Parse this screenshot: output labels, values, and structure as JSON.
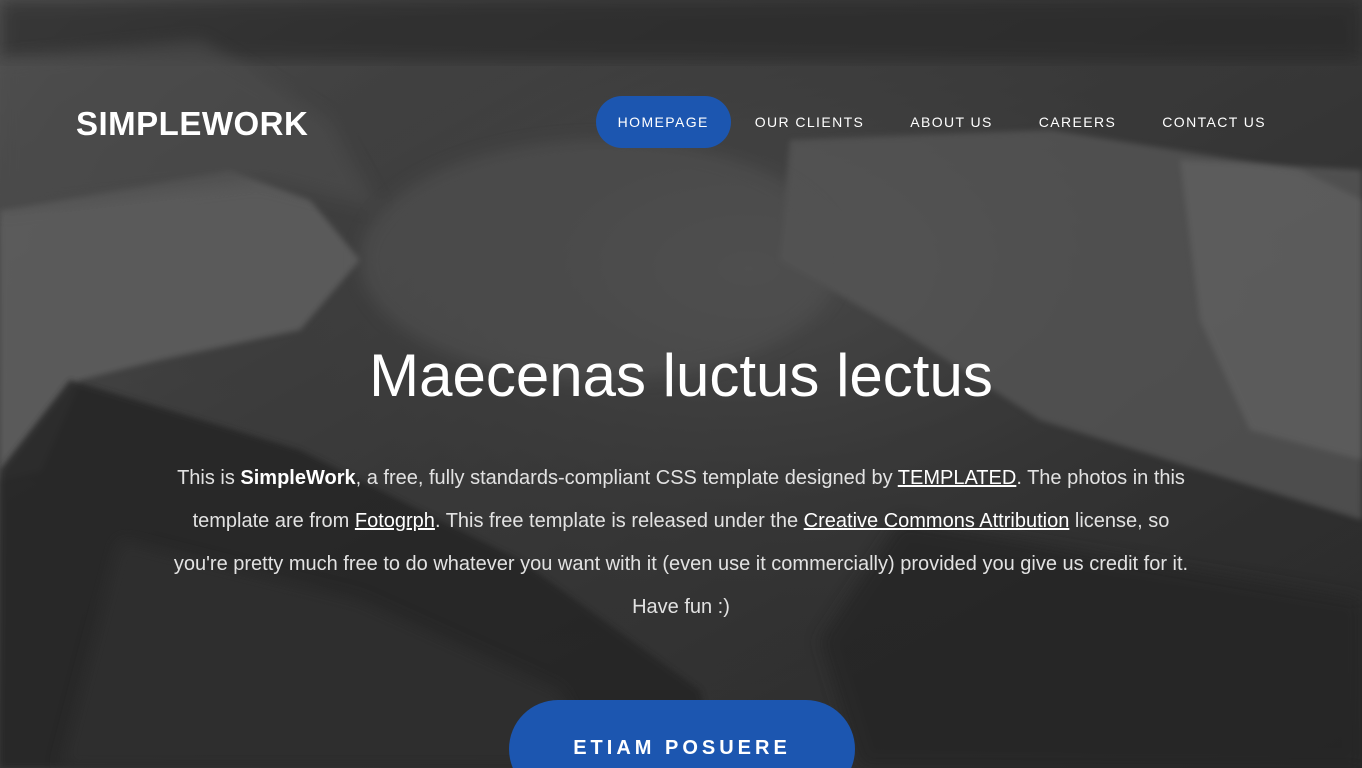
{
  "brand": {
    "logo_text": "SIMPLEWORK"
  },
  "nav": {
    "items": [
      {
        "label": "HOMEPAGE",
        "active": true
      },
      {
        "label": "OUR CLIENTS",
        "active": false
      },
      {
        "label": "ABOUT US",
        "active": false
      },
      {
        "label": "CAREERS",
        "active": false
      },
      {
        "label": "CONTACT US",
        "active": false
      }
    ]
  },
  "hero": {
    "title": "Maecenas luctus lectus",
    "intro": {
      "part1": "This is ",
      "brand_bold": "SimpleWork",
      "part2": ", a free, fully standards-compliant CSS template designed by ",
      "link1": "TEMPLATED",
      "part3": ". The photos in this template are from ",
      "link2": "Fotogrph",
      "part4": ". This free template is released under the ",
      "link3": "Creative Commons Attribution",
      "part5": " license, so you're pretty much free to do whatever you want with it (even use it commercially) provided you give us credit for it. Have fun :)"
    },
    "cta_label": "ETIAM POSUERE"
  },
  "colors": {
    "accent": "#1c56b0",
    "text": "#ffffff",
    "overlay": "#3a3a3a"
  }
}
